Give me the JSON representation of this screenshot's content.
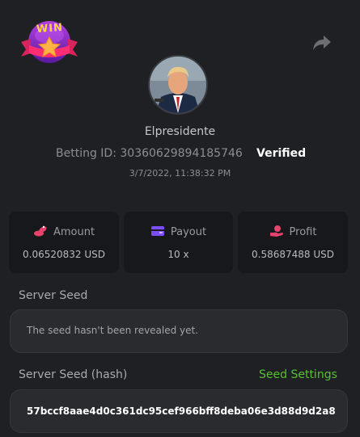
{
  "header": {
    "logo_text": "WIN",
    "logo_icon": "win-badge-logo",
    "share_icon": "share-icon"
  },
  "profile": {
    "avatar": "user-avatar",
    "username": "Elpresidente",
    "betting_id_label": "Betting ID:",
    "betting_id": "30360629894185746",
    "verified": "Verified",
    "timestamp": "3/7/2022, 11:38:32 PM"
  },
  "stats": [
    {
      "label": "Amount",
      "value": "0.06520832 USD",
      "icon": "coins-icon",
      "color": "#e8436d"
    },
    {
      "label": "Payout",
      "value": "10 x",
      "icon": "wallet-icon",
      "color": "#7b4dff"
    },
    {
      "label": "Profit",
      "value": "0.58687488 USD",
      "icon": "hand-money-icon",
      "color": "#e8436d"
    }
  ],
  "server_seed": {
    "label": "Server Seed",
    "value": "The seed hasn't been revealed yet."
  },
  "server_seed_hash": {
    "label": "Server Seed (hash)",
    "settings_link": "Seed Settings",
    "value": "57bccf8aae4d0c361dc95cef966bff8deba06e3d88d9d2a8"
  },
  "colors": {
    "background": "#1f2023",
    "card": "#17181b",
    "accent_green": "#57c22f",
    "accent_pink": "#e8436d",
    "accent_purple": "#7b4dff"
  }
}
